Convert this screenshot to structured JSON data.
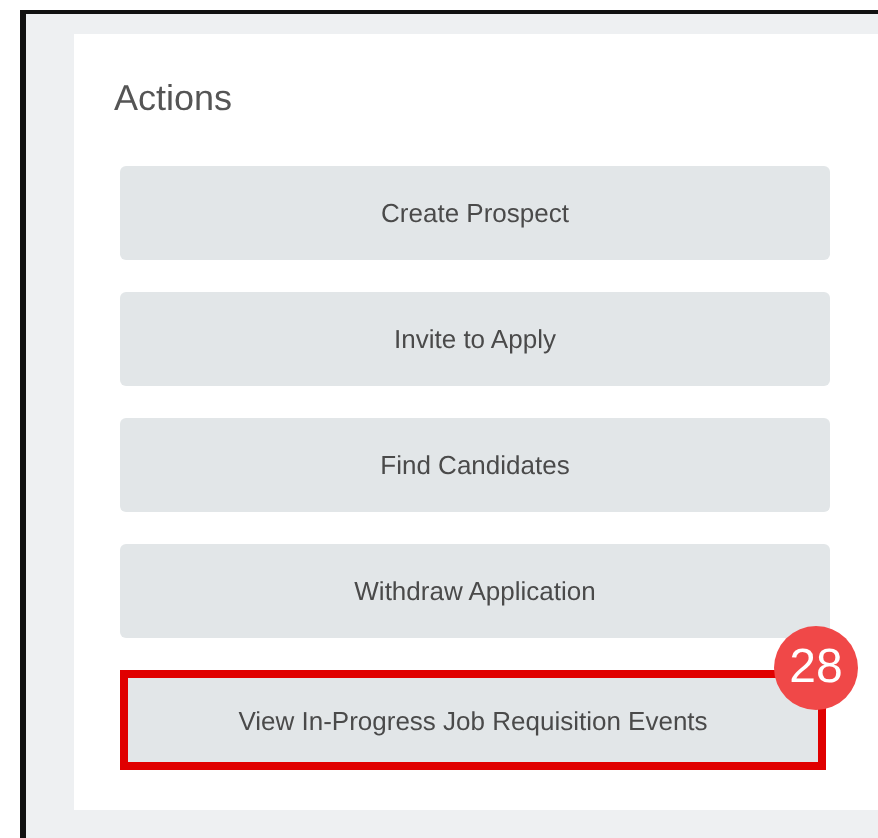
{
  "card": {
    "title": "Actions"
  },
  "actions": [
    {
      "label": "Create Prospect",
      "highlighted": false
    },
    {
      "label": "Invite to Apply",
      "highlighted": false
    },
    {
      "label": "Find Candidates",
      "highlighted": false
    },
    {
      "label": "Withdraw Application",
      "highlighted": false
    },
    {
      "label": "View In-Progress Job Requisition Events",
      "highlighted": true,
      "callout": "28"
    }
  ]
}
